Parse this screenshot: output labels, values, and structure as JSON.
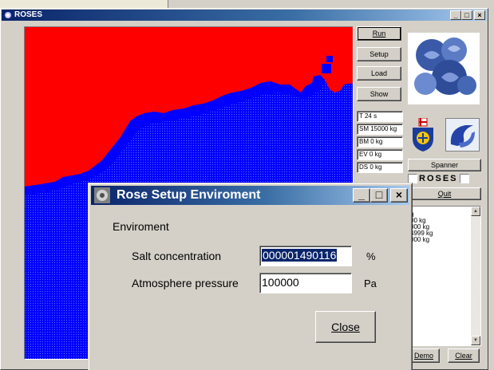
{
  "window": {
    "title": "ROSES",
    "controls": {
      "minimize": "_",
      "maximize": "□",
      "close": "×"
    }
  },
  "colors": {
    "land": "#ff0000",
    "sea": "#0000ff",
    "titlebar": "#0a246a"
  },
  "panel": {
    "buttons": {
      "run": "Run",
      "setup": "Setup",
      "load": "Load",
      "show": "Show",
      "spanner": "Spanner",
      "quit": "Quit",
      "demo": "Demo",
      "clear": "Clear"
    },
    "stats": {
      "time": "T 24 s",
      "sm": "SM 15000 kg",
      "bm": "BM 0 kg",
      "ev": "EV 0 kg",
      "ds": "DS 0 kg"
    },
    "roses_label": "ROSES",
    "log_lines": [
      "g",
      "00 kg",
      "000 kg",
      "4999 kg",
      "000 kg"
    ]
  },
  "icons": {
    "photo": "blue-roses-image",
    "logo1": "coat-of-arms-icon",
    "logo2": "wave-logo-icon",
    "app": "rose-app-icon"
  },
  "dialog": {
    "title": "Rose Setup Enviroment",
    "group_label": "Enviroment",
    "salt_label": "Salt concentration",
    "salt_value": "000001490116",
    "salt_unit": "%",
    "pressure_label": "Atmosphere pressure",
    "pressure_value": "100000",
    "pressure_unit": "Pa",
    "close_label": "Close",
    "controls": {
      "minimize": "_",
      "maximize": "□",
      "close": "×"
    }
  }
}
